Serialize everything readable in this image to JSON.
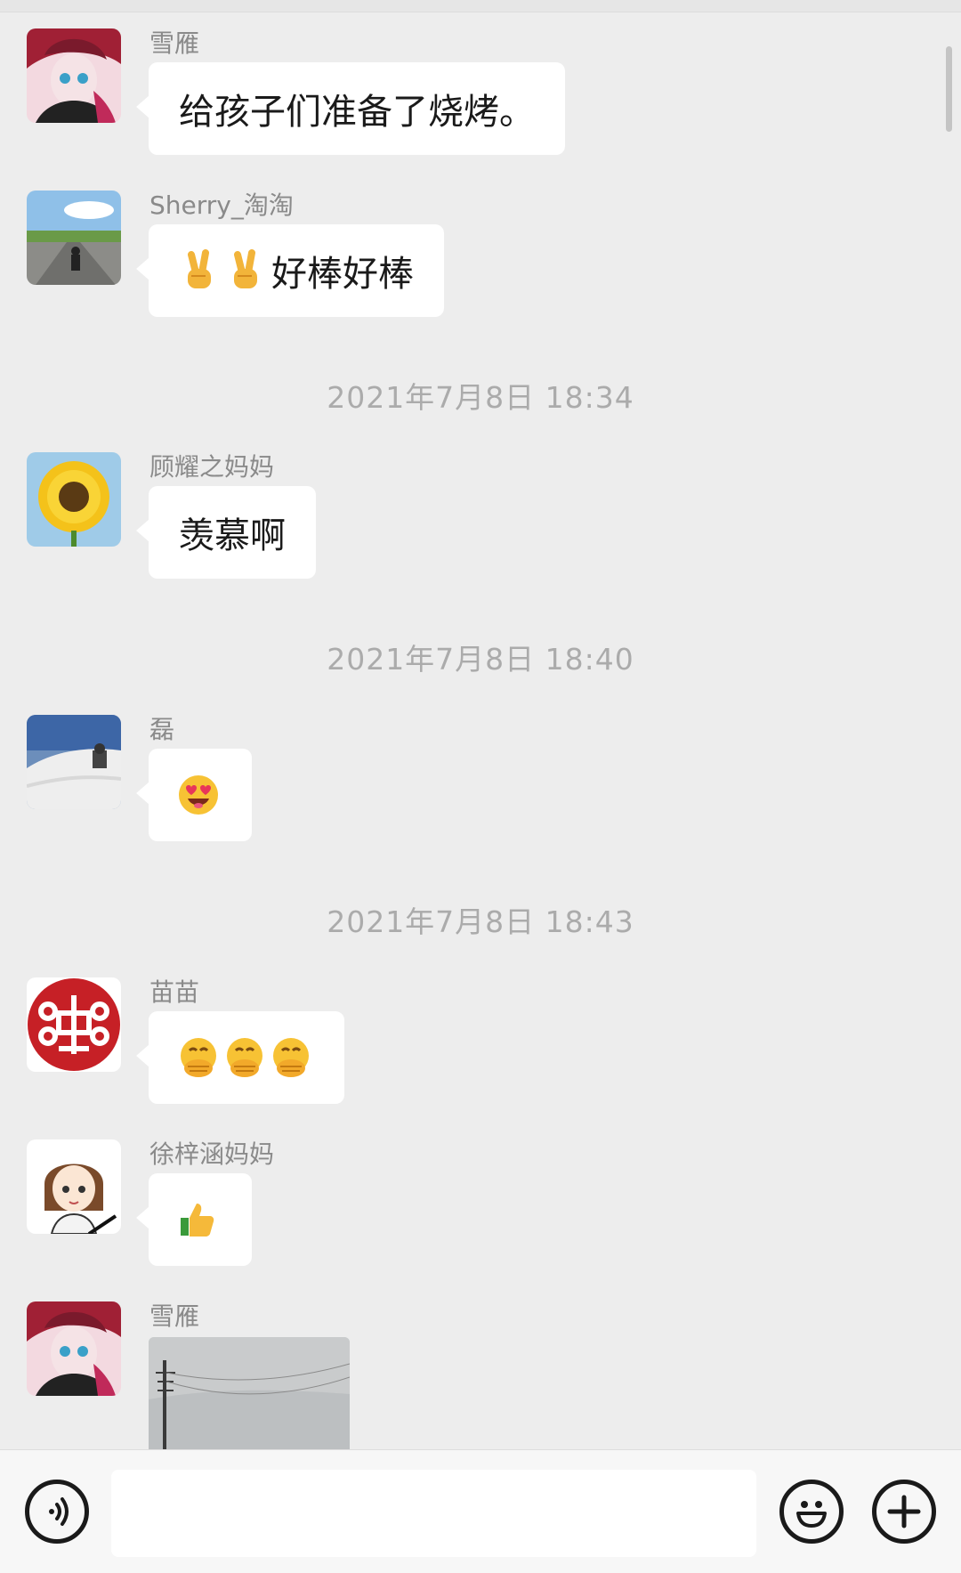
{
  "messages": [
    {
      "sender": "雪雁",
      "text": "给孩子们准备了烧烤。"
    },
    {
      "sender": "Sherry_淘淘",
      "text": "好棒好棒",
      "emoji": [
        "victory-hand",
        "victory-hand"
      ]
    },
    {
      "timestamp": "2021年7月8日 18:34"
    },
    {
      "sender": "顾耀之妈妈",
      "text": "羡慕啊"
    },
    {
      "timestamp": "2021年7月8日 18:40"
    },
    {
      "sender": "磊",
      "emoji": [
        "heart-eyes-face"
      ]
    },
    {
      "timestamp": "2021年7月8日 18:43"
    },
    {
      "sender": "苗苗",
      "emoji": [
        "hand-over-mouth-face",
        "hand-over-mouth-face",
        "hand-over-mouth-face"
      ]
    },
    {
      "sender": "徐梓涵妈妈",
      "emoji": [
        "thumbs-up"
      ]
    },
    {
      "sender": "雪雁",
      "image": "photo"
    }
  ],
  "input": {
    "value": ""
  },
  "icons": {
    "voice": "voice-icon",
    "emoji": "emoji-icon",
    "more": "plus-icon"
  },
  "colors": {
    "background": "#ededed",
    "bubble": "#ffffff",
    "timestamp": "#ababab",
    "sender": "#8a8a8a"
  }
}
